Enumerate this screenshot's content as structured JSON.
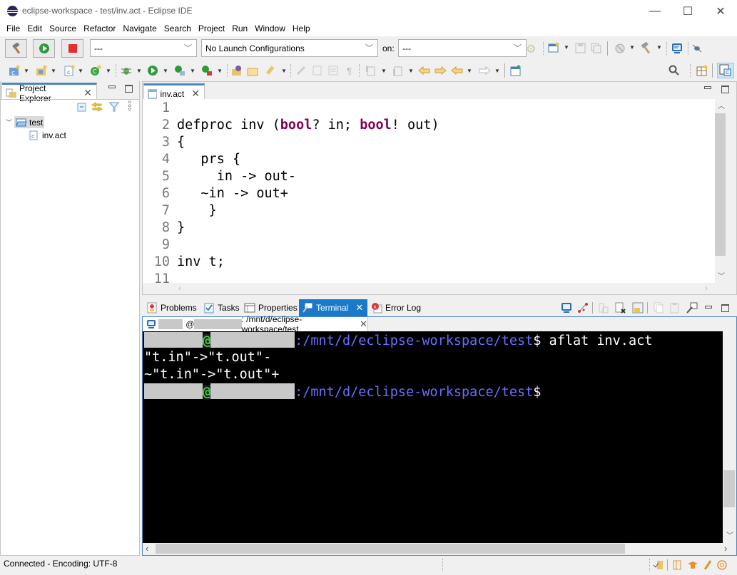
{
  "window": {
    "title": "eclipse-workspace - test/inv.act - Eclipse IDE",
    "minimize": "—",
    "maximize": "☐",
    "close": "✕"
  },
  "menu": [
    "File",
    "Edit",
    "Source",
    "Refactor",
    "Navigate",
    "Search",
    "Project",
    "Run",
    "Window",
    "Help"
  ],
  "launch_toolbar": {
    "mode_combo": "---",
    "config_combo": "No Launch Configurations",
    "on_label": "on:",
    "target_combo": "---"
  },
  "project_explorer": {
    "tab_label": "Project Explorer",
    "tree": [
      {
        "label": "test",
        "type": "folder",
        "expanded": true,
        "selected": true
      },
      {
        "label": "inv.act",
        "type": "file",
        "indent": 1
      }
    ]
  },
  "editor": {
    "tab_label": "inv.act",
    "lines": [
      {
        "n": "1",
        "segments": []
      },
      {
        "n": "2",
        "segments": [
          {
            "t": "defproc inv (",
            "k": false
          },
          {
            "t": "bool",
            "k": true
          },
          {
            "t": "? in; ",
            "k": false
          },
          {
            "t": "bool",
            "k": true
          },
          {
            "t": "! out)",
            "k": false
          }
        ]
      },
      {
        "n": "3",
        "segments": [
          {
            "t": "{",
            "k": false
          }
        ]
      },
      {
        "n": "4",
        "segments": [
          {
            "t": "   prs {",
            "k": false
          }
        ]
      },
      {
        "n": "5",
        "segments": [
          {
            "t": "     in -> out-",
            "k": false
          }
        ]
      },
      {
        "n": "6",
        "segments": [
          {
            "t": "   ~in -> out+",
            "k": false
          }
        ]
      },
      {
        "n": "7",
        "segments": [
          {
            "t": "    }",
            "k": false
          }
        ]
      },
      {
        "n": "8",
        "segments": [
          {
            "t": "}",
            "k": false
          }
        ]
      },
      {
        "n": "9",
        "segments": []
      },
      {
        "n": "10",
        "segments": [
          {
            "t": "inv t;",
            "k": false
          }
        ]
      },
      {
        "n": "11",
        "segments": []
      }
    ]
  },
  "bottom_tabs": [
    {
      "label": "Problems",
      "icon": "problems-icon",
      "active": false
    },
    {
      "label": "Tasks",
      "icon": "tasks-icon",
      "active": false
    },
    {
      "label": "Properties",
      "icon": "properties-icon",
      "active": false
    },
    {
      "label": "Terminal",
      "icon": "terminal-icon",
      "active": true
    },
    {
      "label": "Error Log",
      "icon": "error-log-icon",
      "active": false
    }
  ],
  "terminal": {
    "session_tab": {
      "at": "@",
      "path": ": /mnt/d/eclipse-workspace/test"
    },
    "lines": [
      {
        "type": "prompt",
        "at": "@",
        "path": ":/mnt/d/eclipse-workspace/test",
        "symbol": "$",
        "command": " aflat inv.act"
      },
      {
        "type": "output",
        "text": "\"t.in\"->\"t.out\"-"
      },
      {
        "type": "output",
        "text": "~\"t.in\"->\"t.out\"+"
      },
      {
        "type": "prompt",
        "at": "@",
        "path": ":/mnt/d/eclipse-workspace/test",
        "symbol": "$",
        "command": ""
      }
    ]
  },
  "status_bar": {
    "text": "Connected - Encoding: UTF-8"
  },
  "colors": {
    "keyword": "#7f0055",
    "terminal_bg": "#000000",
    "prompt_at": "#3fd13f",
    "prompt_path": "#6b6bff",
    "active_tab": "#1979ca",
    "tab_top_border": "#4c87c1"
  }
}
